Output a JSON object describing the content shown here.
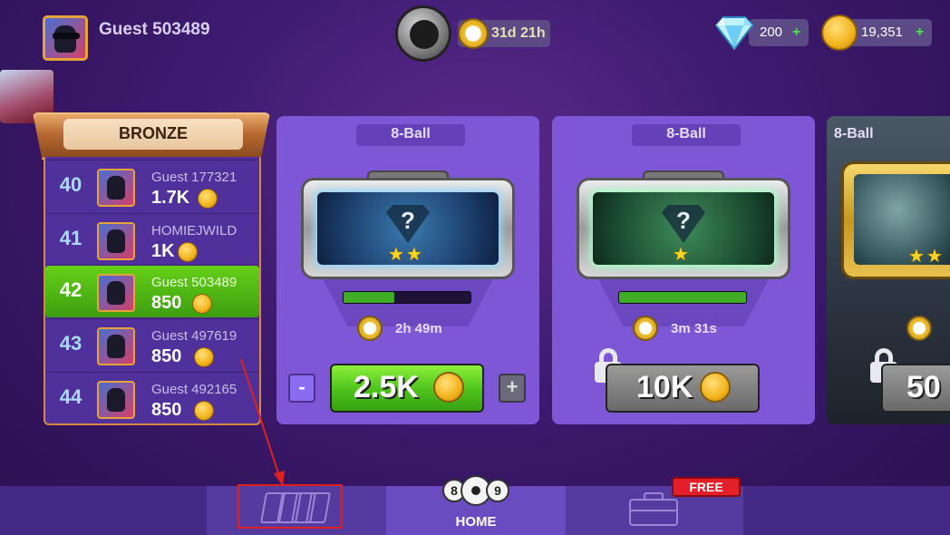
{
  "header": {
    "player_name": "Guest 503489",
    "event_timer": "31d 21h",
    "gems": "200",
    "gems_plus": "+",
    "coins": "19,351",
    "coins_plus": "+"
  },
  "leaderboard": {
    "league": "BRONZE",
    "rows": [
      {
        "rank": "40",
        "name": "Guest 177321",
        "score": "1.7K"
      },
      {
        "rank": "41",
        "name": "HOMIEJWILD",
        "score": "1K"
      },
      {
        "rank": "42",
        "name": "Guest 503489",
        "score": "850",
        "is_current_player": true
      },
      {
        "rank": "43",
        "name": "Guest 497619",
        "score": "850"
      },
      {
        "rank": "44",
        "name": "Guest 492165",
        "score": "850"
      }
    ]
  },
  "cases": [
    {
      "mode": "8-Ball",
      "stars": 2,
      "timer": "2h 49m",
      "price": "2.5K",
      "progress": 0.4,
      "locked": false,
      "minus": "-",
      "plus": "+"
    },
    {
      "mode": "8-Ball",
      "stars": 1,
      "timer": "3m 31s",
      "price": "10K",
      "progress": 1.0,
      "locked": true
    },
    {
      "mode": "8-Ball",
      "stars": 2,
      "price": "50",
      "locked": true
    }
  ],
  "bottom_nav": {
    "home_label": "HOME",
    "ball_8": "8",
    "ball_9": "9",
    "free_badge": "FREE"
  },
  "colors": {
    "accent_green": "#4cc21c",
    "highlight_red": "#e02020",
    "background": "#3d1a6e"
  }
}
